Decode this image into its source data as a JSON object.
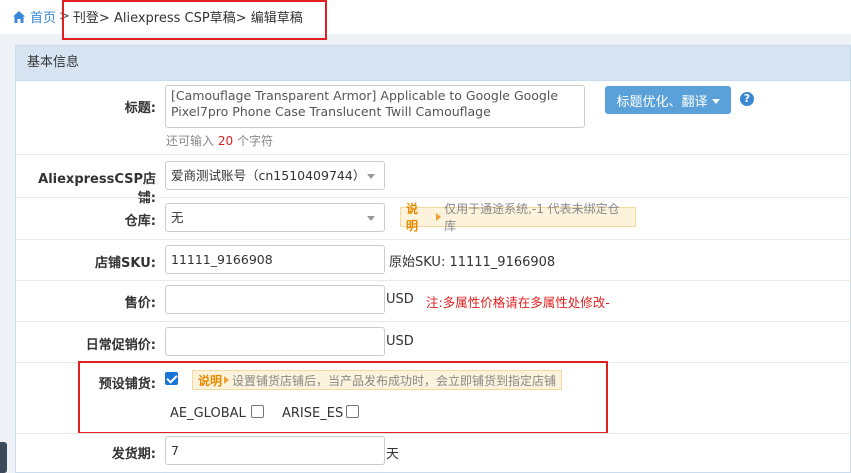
{
  "breadcrumb": {
    "home": "首页",
    "sep": ">",
    "path": "刊登> Aliexpress CSP草稿> 编辑草稿"
  },
  "panel": {
    "title": "基本信息"
  },
  "title_field": {
    "label": "标题:",
    "value": "[Camouflage Transparent Armor] Applicable to Google Google Pixel7pro Phone Case Translucent Twill Camouflage",
    "hint_prefix": "还可输入",
    "hint_count": "20",
    "hint_suffix": "个字符",
    "optimize_button": "标题优化、翻译",
    "help": "?"
  },
  "store_field": {
    "label": "AliexpressCSP店铺:",
    "value": "爱商测试账号（cn1510409744）"
  },
  "warehouse_field": {
    "label": "仓库:",
    "value": "无",
    "note_tag": "说 明",
    "note_text": "仅用于通途系统,-1 代表未绑定仓库"
  },
  "sku_field": {
    "label": "店铺SKU:",
    "value": "11111_9166908",
    "original": "原始SKU: 11111_9166908"
  },
  "price_field": {
    "label": "售价:",
    "value": "",
    "unit": "USD",
    "note": "注:多属性价格请在多属性处修改-"
  },
  "promo_field": {
    "label": "日常促销价:",
    "value": "",
    "unit": "USD"
  },
  "preset_field": {
    "label": "预设铺货:",
    "checked": true,
    "note_tag": "说明",
    "note_text": "设置铺货店铺后，当产品发布成功时，会立即铺货到指定店铺",
    "options": [
      {
        "label": "AE_GLOBAL",
        "checked": false
      },
      {
        "label": "ARISE_ES",
        "checked": false
      }
    ]
  },
  "ship_field": {
    "label": "发货期:",
    "value": "7",
    "unit": "天"
  },
  "colors": {
    "accent": "#5aa1d9",
    "link": "#3a87d6",
    "highlight": "#e02020",
    "panel_head": "#d6e4f2"
  }
}
